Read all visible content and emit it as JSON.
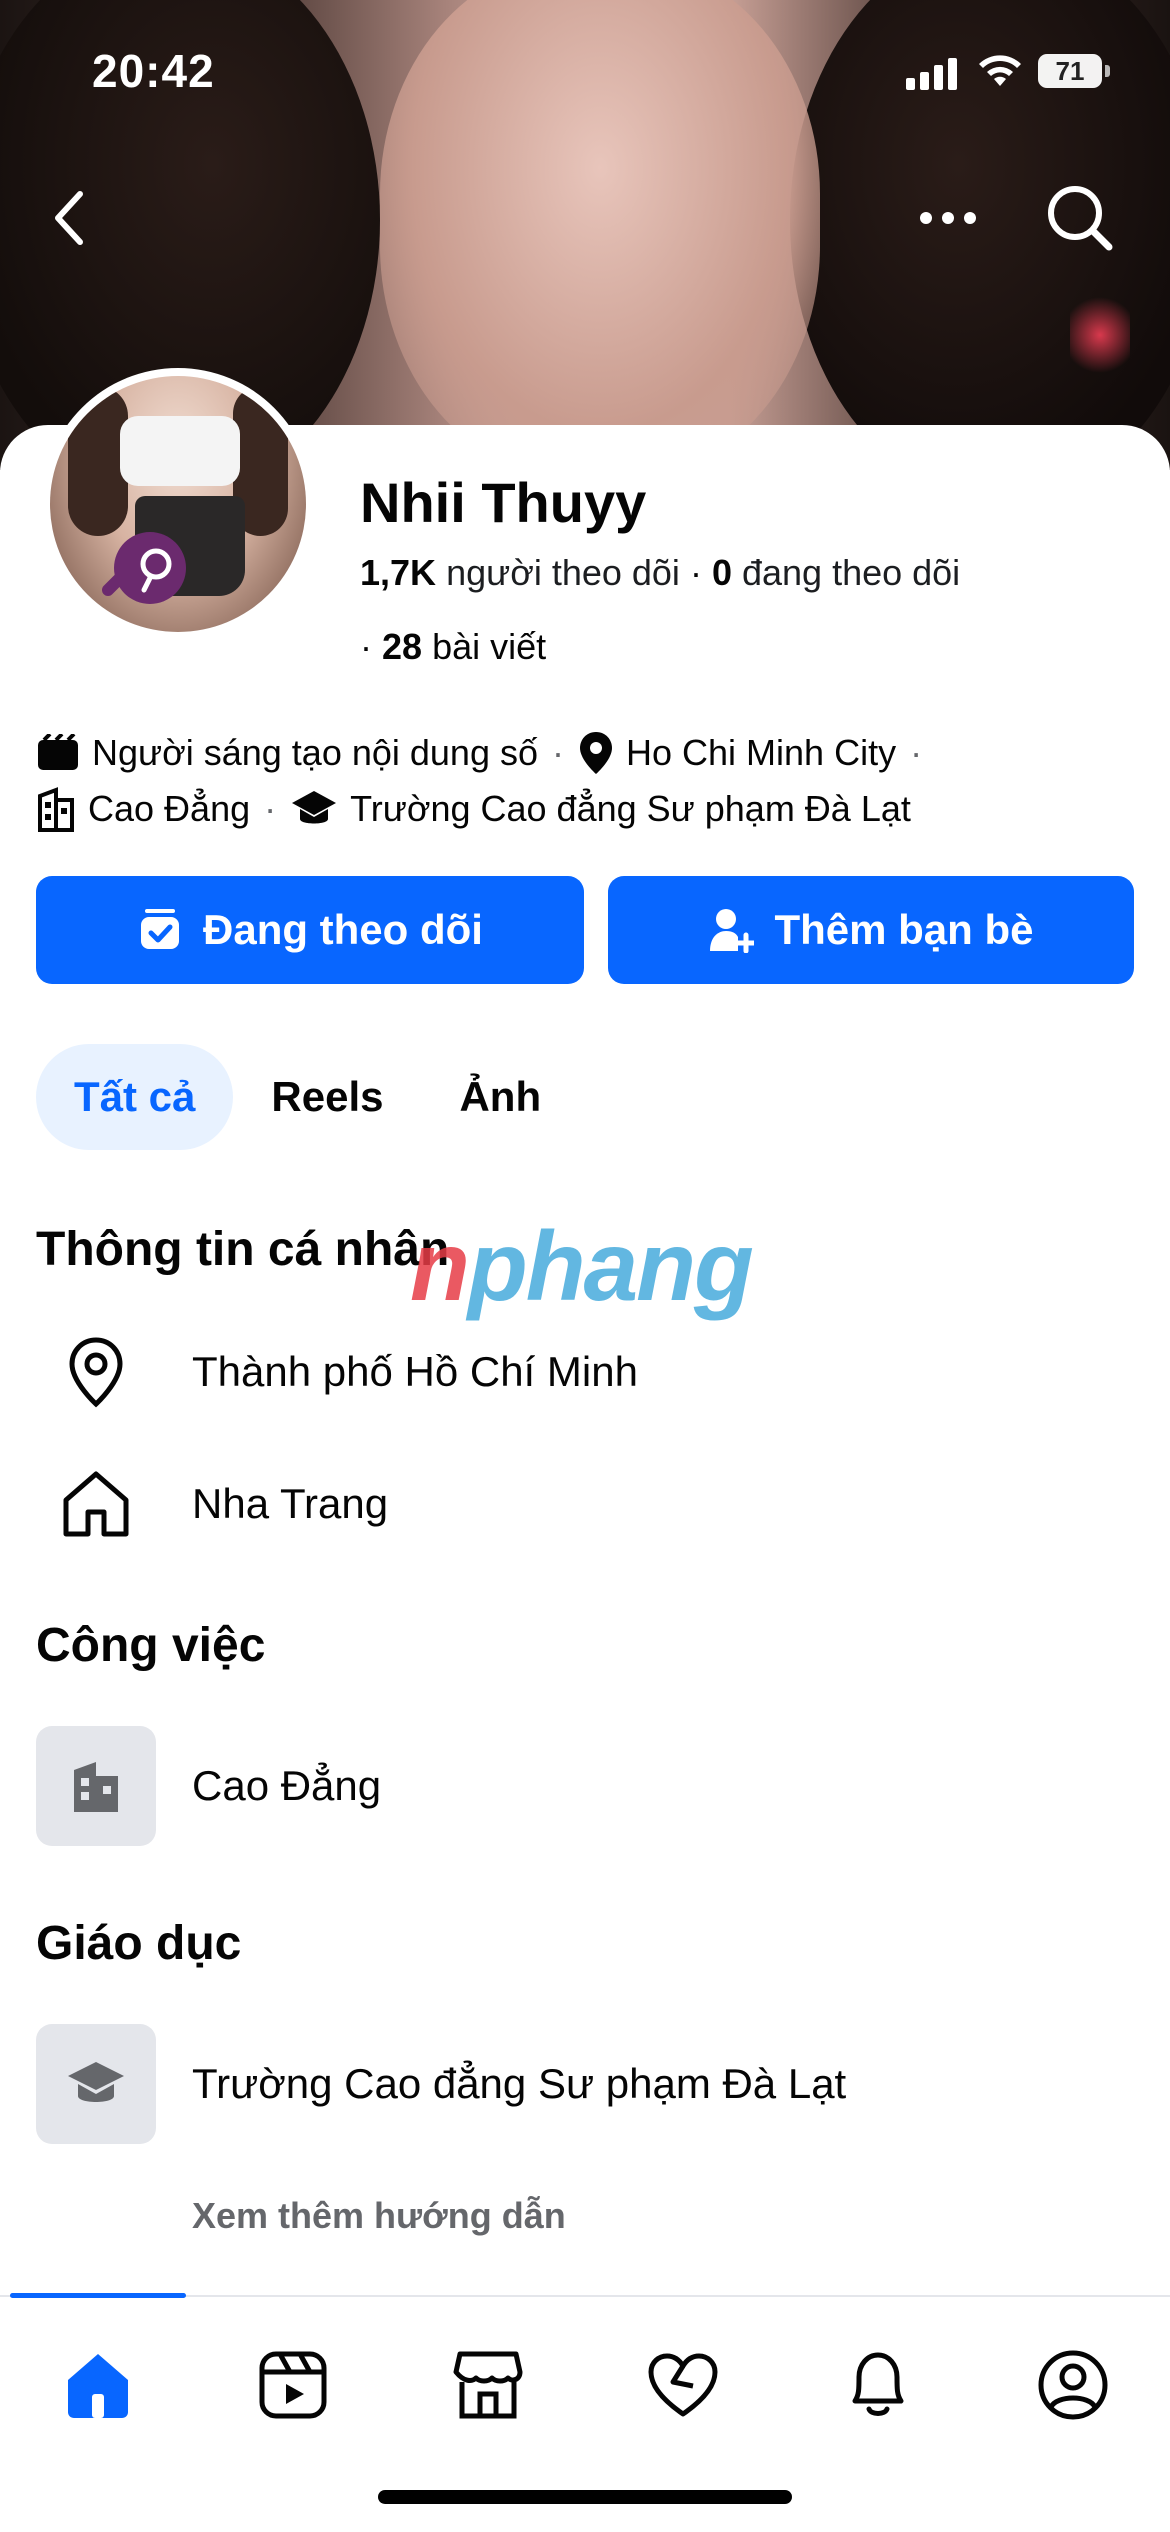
{
  "status_bar": {
    "time": "20:42",
    "battery": "71"
  },
  "top_nav": {
    "back_icon": "chevron-left-icon",
    "more_icon": "more-dots-icon",
    "search_icon": "search-icon"
  },
  "profile": {
    "name": "Nhii Thuyy",
    "followers_count": "1,7K",
    "followers_label": "người theo dõi",
    "following_count": "0",
    "following_label": "đang theo dõi",
    "posts_prefix": "·",
    "posts_count": "28",
    "posts_label": "bài viết"
  },
  "intro": {
    "category": "Người sáng tạo nội dung số",
    "location": "Ho Chi Minh City",
    "work": "Cao Đẳng",
    "education": "Trường Cao đẳng Sư phạm Đà Lạt"
  },
  "actions": {
    "following_label": "Đang theo dõi",
    "add_friend_label": "Thêm bạn bè"
  },
  "tabs": [
    {
      "label": "Tất cả",
      "active": true
    },
    {
      "label": "Reels",
      "active": false
    },
    {
      "label": "Ảnh",
      "active": false
    }
  ],
  "watermark": {
    "part1": "n",
    "part2": "phang"
  },
  "personal_info": {
    "title": "Thông tin cá nhân",
    "items": [
      {
        "icon": "location-pin-icon",
        "text": "Thành phố Hồ Chí Minh"
      },
      {
        "icon": "home-icon",
        "text": "Nha Trang"
      }
    ]
  },
  "work_section": {
    "title": "Công việc",
    "items": [
      {
        "icon": "building-icon",
        "text": "Cao Đẳng"
      }
    ]
  },
  "education_section": {
    "title": "Giáo dục",
    "items": [
      {
        "icon": "graduation-cap-icon",
        "text": "Trường Cao đẳng Sư phạm Đà Lạt"
      }
    ]
  },
  "see_more": "Xem thêm hướng dẫn",
  "bottom_nav": [
    "home-icon",
    "reels-icon",
    "marketplace-icon",
    "dating-heart-icon",
    "notifications-bell-icon",
    "profile-icon"
  ],
  "colors": {
    "accent": "#0866ff",
    "tab_active_bg": "#e8f2ff",
    "muted": "#65676b"
  }
}
